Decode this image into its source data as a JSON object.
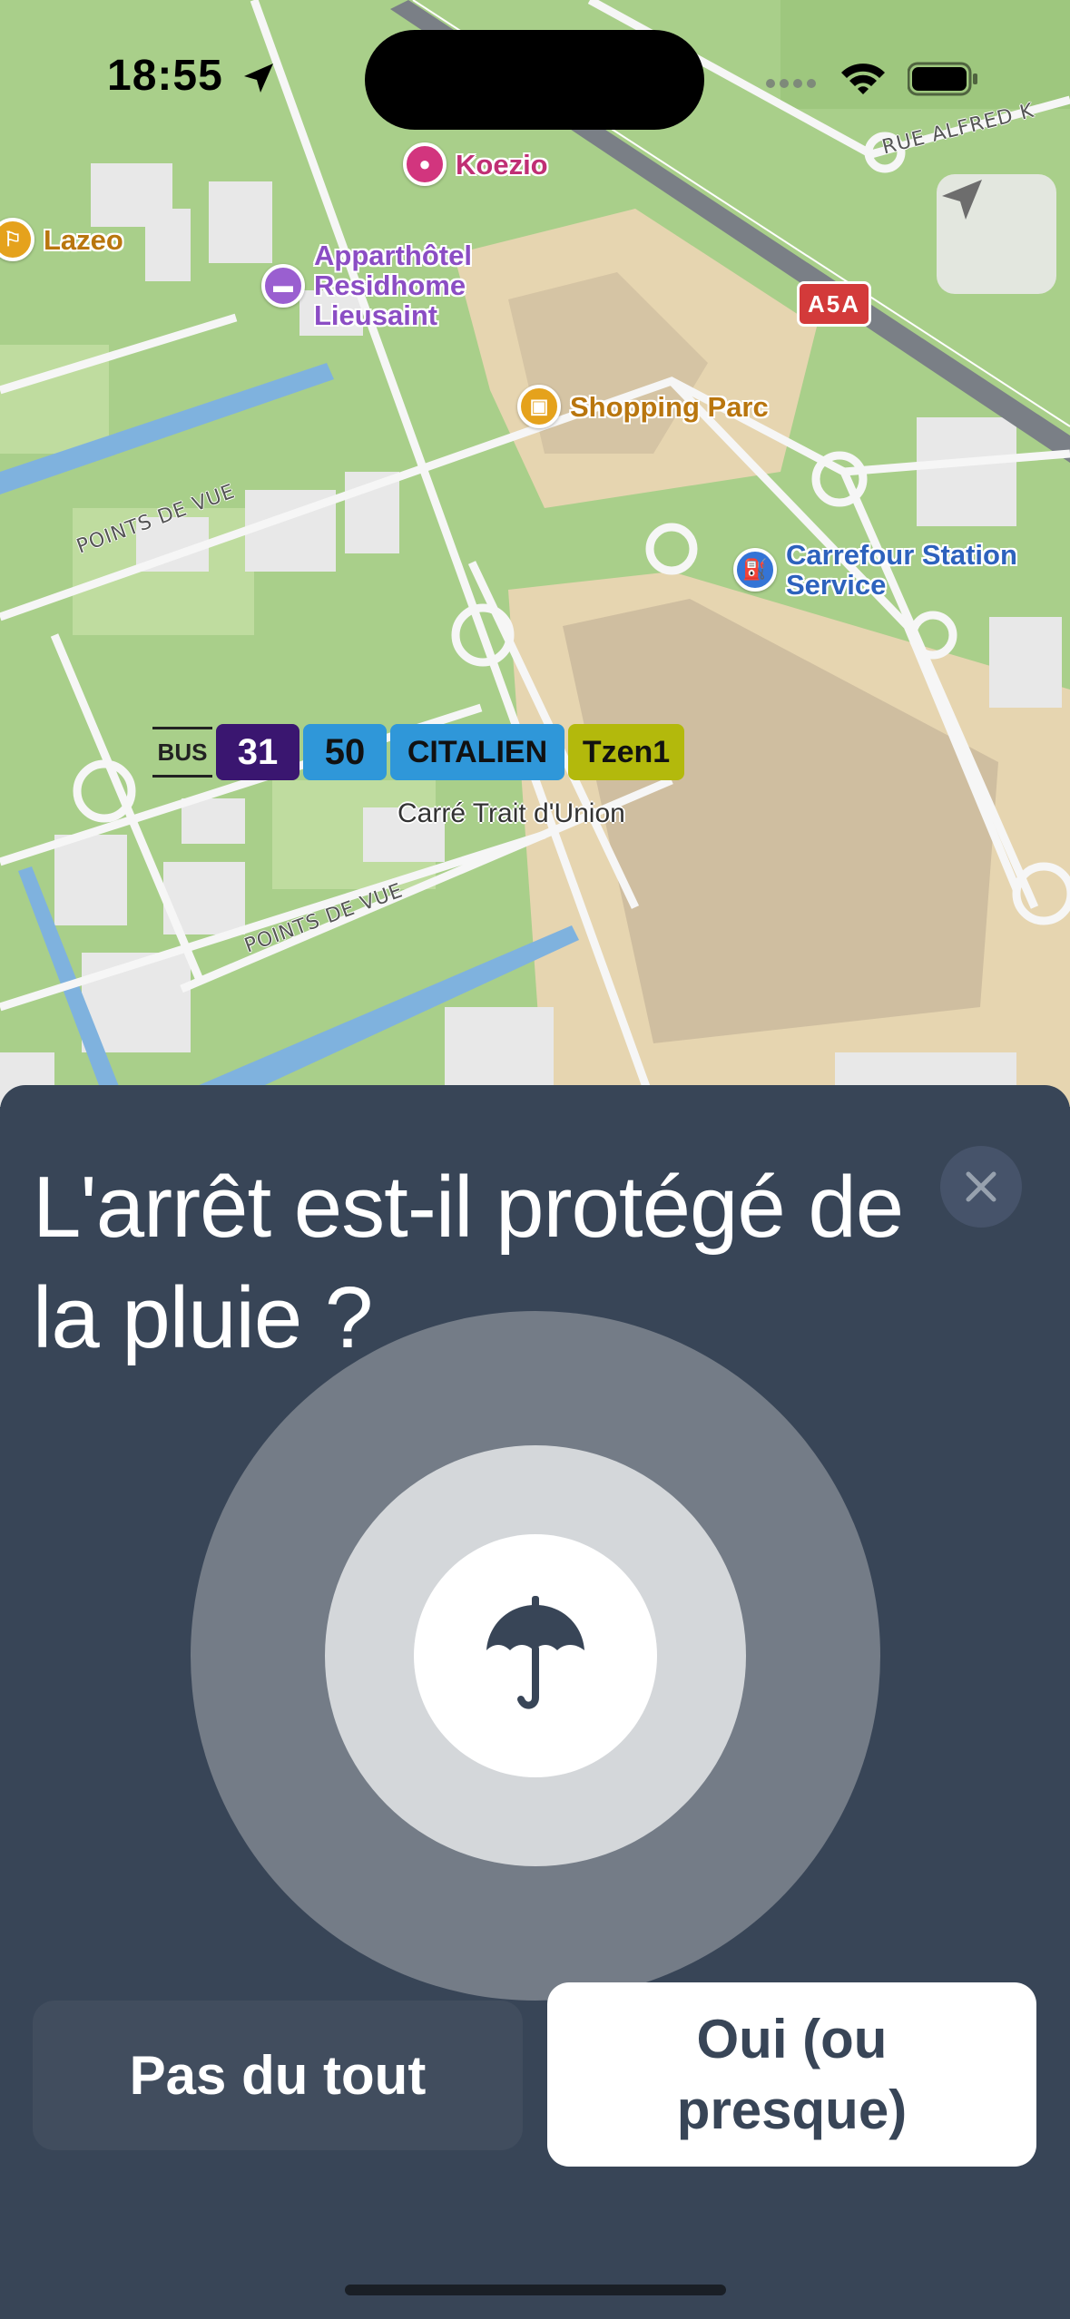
{
  "status_bar": {
    "time": "18:55"
  },
  "map": {
    "pois": [
      {
        "label": "Koezio",
        "color": "#d2357e"
      },
      {
        "label": "Lazeo",
        "color": "#e5a21c"
      },
      {
        "label": "Apparthôtel Residhome Lieusaint",
        "color": "#9a5fd0"
      },
      {
        "label": "Shopping Parc",
        "color": "#e5a21c"
      },
      {
        "label": "Carrefour Station Service",
        "color": "#3474d6"
      }
    ],
    "road_labels": [
      "RUE ALFRED K",
      "POINTS DE VUE",
      "POINTS DE VUE"
    ],
    "highway_badge": "A5A",
    "transit_stop": {
      "mode": "BUS",
      "lines": [
        {
          "label": "31",
          "bg": "#3a1670",
          "fg": "#ffffff"
        },
        {
          "label": "50",
          "bg": "#2f97d9",
          "fg": "#111111"
        },
        {
          "label": "CITALIEN",
          "bg": "#2f97d9",
          "fg": "#111111"
        },
        {
          "label": "Tzen1",
          "bg": "#b3b90c",
          "fg": "#111111"
        }
      ],
      "name": "Carré Trait d'Union"
    }
  },
  "sheet": {
    "question": "L'arrêt est-il protégé de la pluie ?",
    "icon": "umbrella-icon",
    "button_no": "Pas du tout",
    "button_yes": "Oui (ou presque)"
  }
}
